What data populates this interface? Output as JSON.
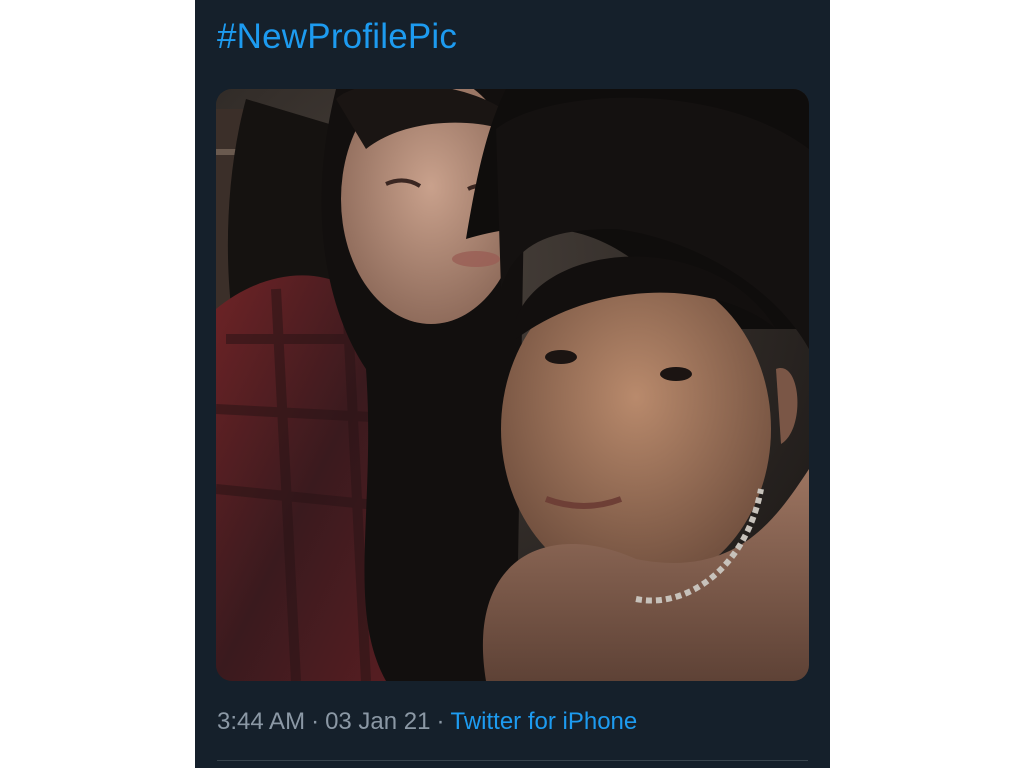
{
  "tweet": {
    "text": "#NewProfilePic",
    "timestamp": {
      "time": "3:44 AM",
      "separator": "·",
      "date": "03 Jan 21"
    },
    "source_label": "Twitter for iPhone"
  },
  "photo": {
    "description_icon": "photo-image"
  },
  "colors": {
    "background": "#15202b",
    "link": "#1d9bf0",
    "meta_text": "#8b98a5",
    "divider": "#38444d"
  }
}
